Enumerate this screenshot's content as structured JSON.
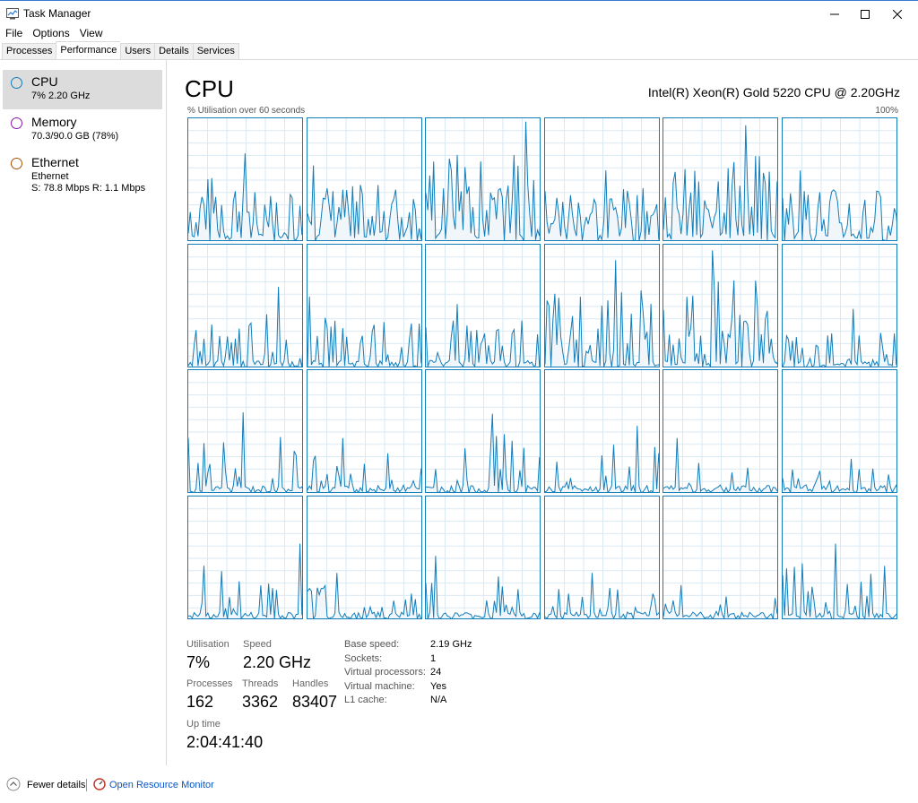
{
  "window": {
    "title": "Task Manager",
    "icon": "task-manager-icon"
  },
  "menu": [
    "File",
    "Options",
    "View"
  ],
  "tabs": [
    "Processes",
    "Performance",
    "Users",
    "Details",
    "Services"
  ],
  "active_tab": "Performance",
  "sidebar": {
    "items": [
      {
        "name": "CPU",
        "sub1": "7%  2.20 GHz",
        "sub2": "",
        "color": "#117dbb"
      },
      {
        "name": "Memory",
        "sub1": "70.3/90.0 GB (78%)",
        "sub2": "",
        "color": "#8b12ae"
      },
      {
        "name": "Ethernet",
        "sub1": "Ethernet",
        "sub2": "S: 78.8 Mbps  R: 1.1 Mbps",
        "color": "#a74f01"
      }
    ]
  },
  "main": {
    "title": "CPU",
    "cpu_model": "Intel(R) Xeon(R) Gold 5220 CPU @ 2.20GHz",
    "axis_left": "% Utilisation over 60 seconds",
    "axis_right": "100%"
  },
  "colors": {
    "accent": "#117dbb",
    "graph_fill": "#f1f6fa",
    "grid": "#d9eaf4"
  },
  "core_peaks": [
    0.72,
    0.62,
    0.98,
    0.58,
    0.95,
    0.58,
    0.66,
    0.58,
    0.52,
    0.88,
    0.96,
    0.48,
    0.66,
    0.45,
    0.65,
    0.55,
    0.45,
    0.28,
    0.62,
    0.38,
    0.52,
    0.38,
    0.28,
    0.62
  ],
  "stats": {
    "utilisation_label": "Utilisation",
    "utilisation_value": "7%",
    "speed_label": "Speed",
    "speed_value": "2.20 GHz",
    "processes_label": "Processes",
    "processes_value": "162",
    "threads_label": "Threads",
    "threads_value": "3362",
    "handles_label": "Handles",
    "handles_value": "83407",
    "uptime_label": "Up time",
    "uptime_value": "2:04:41:40"
  },
  "details": [
    {
      "label": "Base speed:",
      "value": "2.19 GHz"
    },
    {
      "label": "Sockets:",
      "value": "1"
    },
    {
      "label": "Virtual processors:",
      "value": "24"
    },
    {
      "label": "Virtual machine:",
      "value": "Yes"
    },
    {
      "label": "L1 cache:",
      "value": "N/A"
    }
  ],
  "footer": {
    "fewer_details": "Fewer details",
    "open_resource_monitor": "Open Resource Monitor"
  }
}
